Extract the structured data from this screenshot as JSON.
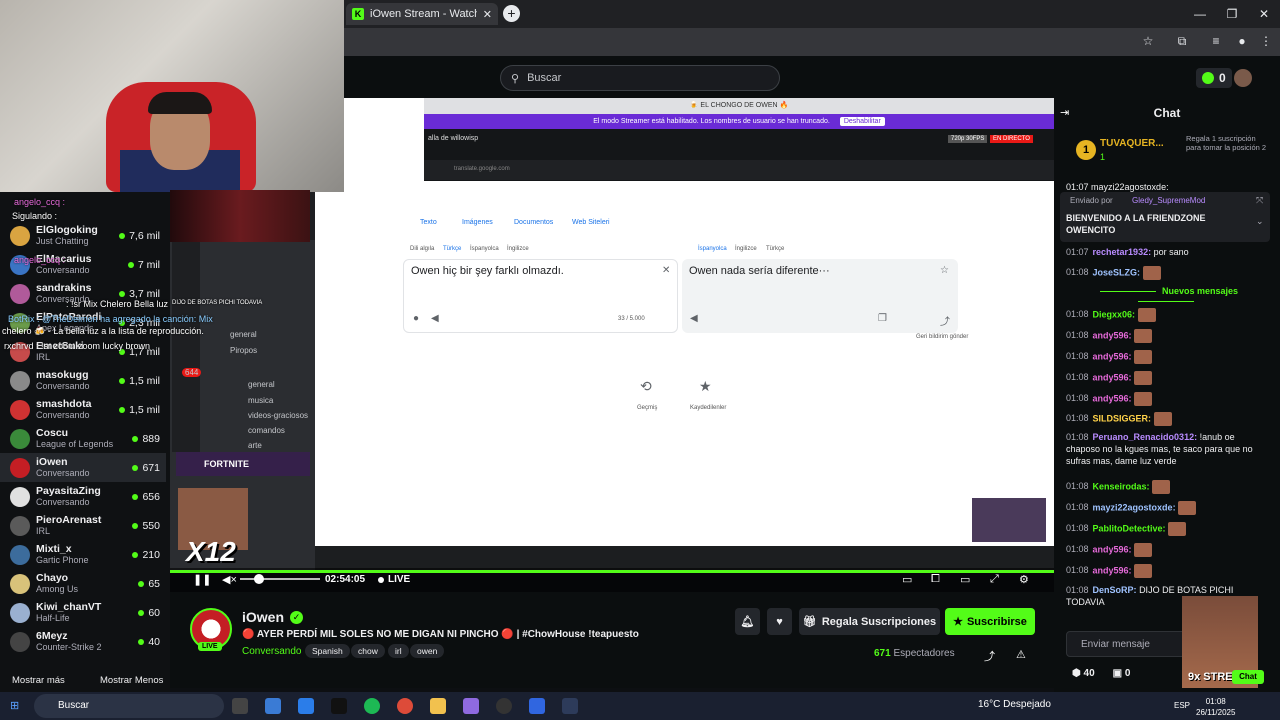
{
  "browser": {
    "tab_title": "iOwen Stream - Watch Live on ...",
    "bookmark_icon": "star-icon"
  },
  "header": {
    "search_placeholder": "Buscar",
    "points": "0"
  },
  "sidebar": {
    "channels": [
      {
        "name": "ElGlogoking",
        "game": "Just Chatting",
        "viewers": "7,6 mil",
        "color": "#d9a441"
      },
      {
        "name": "ElMacarius",
        "game": "Conversando",
        "viewers": "7 mil",
        "color": "#3a74c4"
      },
      {
        "name": "sandrakins",
        "game": "Conversando",
        "viewers": "3,7 mil",
        "color": "#b05a9a"
      },
      {
        "name": "ElPatoParodi",
        "game": "Apex Legends",
        "viewers": "2,3 mil",
        "color": "#6a9b4a"
      },
      {
        "name": "EmetSuki",
        "game": "IRL",
        "viewers": "1,7 mil",
        "color": "#c74b4b"
      },
      {
        "name": "masokugg",
        "game": "Conversando",
        "viewers": "1,5 mil",
        "color": "#8a8a8a"
      },
      {
        "name": "smashdota",
        "game": "Conversando",
        "viewers": "1,5 mil",
        "color": "#cf3232"
      },
      {
        "name": "Coscu",
        "game": "League of Legends",
        "viewers": "889",
        "color": "#3a8a3a"
      },
      {
        "name": "iOwen",
        "game": "Conversando",
        "viewers": "671",
        "color": "#c41e24"
      },
      {
        "name": "PayasitaZing",
        "game": "Conversando",
        "viewers": "656",
        "color": "#e0e0e0"
      },
      {
        "name": "PieroArenast",
        "game": "IRL",
        "viewers": "550",
        "color": "#5a5a5a"
      },
      {
        "name": "Mixti_x",
        "game": "Gartic Phone",
        "viewers": "210",
        "color": "#3c6c9c"
      },
      {
        "name": "Chayo",
        "game": "Among Us",
        "viewers": "65",
        "color": "#d8c27a"
      },
      {
        "name": "Kiwi_chanVT",
        "game": "Half-Life",
        "viewers": "60",
        "color": "#9ab0d0"
      },
      {
        "name": "6Meyz",
        "game": "Counter-Strike 2",
        "viewers": "40",
        "color": "#444"
      }
    ],
    "show_more": "Mostrar más",
    "show_less": "Mostrar Menos"
  },
  "overlay_chat": {
    "l1": "angelo_ccq :",
    "l2": "Sigulando :",
    "l3": "angelo_ccq :",
    "l4": ": !sr Mix Chelero Bella luz",
    "l5": "BotRix : @TheDeimon ha agregado la canción: Mix",
    "l6": "chelero 🍻 - La bella luz a la lista de reproducción.",
    "l7": "rxchrvd : !sr zoom zoom lucky brown",
    "l8": "DIJO DE BOTAS PICHI TODAVIA"
  },
  "stream": {
    "inner_title": "🍺 EL CHONGO DE OWEN 🔥",
    "banner_text": "El modo Streamer está habilitado. Los nombres de usuario se han truncado.",
    "banner_button": "Deshabilitar",
    "inner_tag": "EN DIRECTO",
    "inner_res": "720p 30FPS",
    "inner_channel": "alla de willowisp",
    "tabs": [
      "Texto",
      "Imágenes",
      "Documentos",
      "Web Siteleri"
    ],
    "src_langs": [
      "Dili algıla",
      "Türkçe",
      "İspanyolca",
      "İngilizce"
    ],
    "dst_langs": [
      "İspanyolca",
      "İngilizce",
      "Türkçe"
    ],
    "source_text": "Owen hiç bir şey farklı olmazdı.",
    "translated_text": "Owen nada sería diferente···",
    "char_count": "33 / 5.000",
    "history": "Geçmiş",
    "saved": "Kaydedilenler",
    "feedback": "Geri bildirim gönder",
    "x12": "X12",
    "fortnite": "FORTNITE",
    "discord_channels": [
      "general",
      "Piropos",
      "general",
      "musica",
      "videos-graciosos",
      "comandos",
      "arte"
    ],
    "discord_count": "644"
  },
  "player": {
    "time": "02:54:05",
    "live": "LIVE"
  },
  "channel": {
    "name": "iOwen",
    "title": "🔴 AYER PERDÍ MIL SOLES NO ME DIGAN NI PINCHO 🔴 | #ChowHouse !teapuesto",
    "category": "Conversando",
    "tags": [
      "Spanish",
      "chow",
      "irl",
      "owen"
    ],
    "live_badge": "LIVE",
    "gift_button": "Regala Suscripciones",
    "subscribe_button": "Suscribirse",
    "viewers": "671",
    "viewers_label": "Espectadores"
  },
  "chat": {
    "title": "Chat",
    "gift_rank": "1",
    "gift_user": "TUVAQUER...",
    "gift_count": "1",
    "gift_prompt": "Regala 1 suscripción para tomar la posición 2",
    "top_partial": "01:07 mayzi22agostoxde:",
    "pinned_by": "Enviado por",
    "pinned_user": "Gledy_SupremeMod",
    "pinned_text": "BIENVENIDO A LA FRIENDZONE OWENCITO",
    "new_messages": "Nuevos mensajes",
    "messages": [
      {
        "time": "01:07",
        "user": "rechetar1932:",
        "text": "por sano",
        "color": "#b98cff",
        "emote": false
      },
      {
        "time": "01:08",
        "user": "JoseSLZG:",
        "text": "",
        "color": "#9fc3ff",
        "emote": true
      },
      {
        "time": "01:08",
        "user": "Diegxx06:",
        "text": "",
        "color": "#53fc18",
        "emote": true
      },
      {
        "time": "01:08",
        "user": "andy596:",
        "text": "",
        "color": "#e56ad9",
        "emote": true
      },
      {
        "time": "01:08",
        "user": "andy596:",
        "text": "",
        "color": "#e56ad9",
        "emote": true
      },
      {
        "time": "01:08",
        "user": "andy596:",
        "text": "",
        "color": "#e56ad9",
        "emote": true
      },
      {
        "time": "01:08",
        "user": "andy596:",
        "text": "",
        "color": "#e56ad9",
        "emote": true
      },
      {
        "time": "01:08",
        "user": "SILDSIGGER:",
        "text": "",
        "color": "#ffd24a",
        "emote": true
      },
      {
        "time": "01:08",
        "user": "Peruano_Renacido0312:",
        "text": "!anub oe chaposo no la kgues mas, te saco para que no sufras mas, dame luz verde",
        "color": "#b98cff",
        "emote": false
      },
      {
        "time": "01:08",
        "user": "Kenseirodas:",
        "text": "",
        "color": "#53fc18",
        "emote": true
      },
      {
        "time": "01:08",
        "user": "mayzi22agostoxde:",
        "text": "",
        "color": "#9fc3ff",
        "emote": true
      },
      {
        "time": "01:08",
        "user": "PablitoDetective:",
        "text": "",
        "color": "#53fc18",
        "emote": true
      },
      {
        "time": "01:08",
        "user": "andy596:",
        "text": "",
        "color": "#e56ad9",
        "emote": true
      },
      {
        "time": "01:08",
        "user": "andy596:",
        "text": "",
        "color": "#e56ad9",
        "emote": true
      },
      {
        "time": "01:08",
        "user": "DenSoRP:",
        "text": "DIJO DE BOTAS PICHI TODAVIA",
        "color": "#9fc3ff",
        "emote": false
      }
    ],
    "input_placeholder": "Enviar mensaje",
    "points": "40",
    "gifts": "0",
    "streak": "9x STREAK",
    "send_label": "Chat"
  },
  "taskbar": {
    "search": "Buscar",
    "weather": "16°C  Despejado",
    "time": "01:08",
    "date": "26/11/2025",
    "lang": "ESP"
  }
}
